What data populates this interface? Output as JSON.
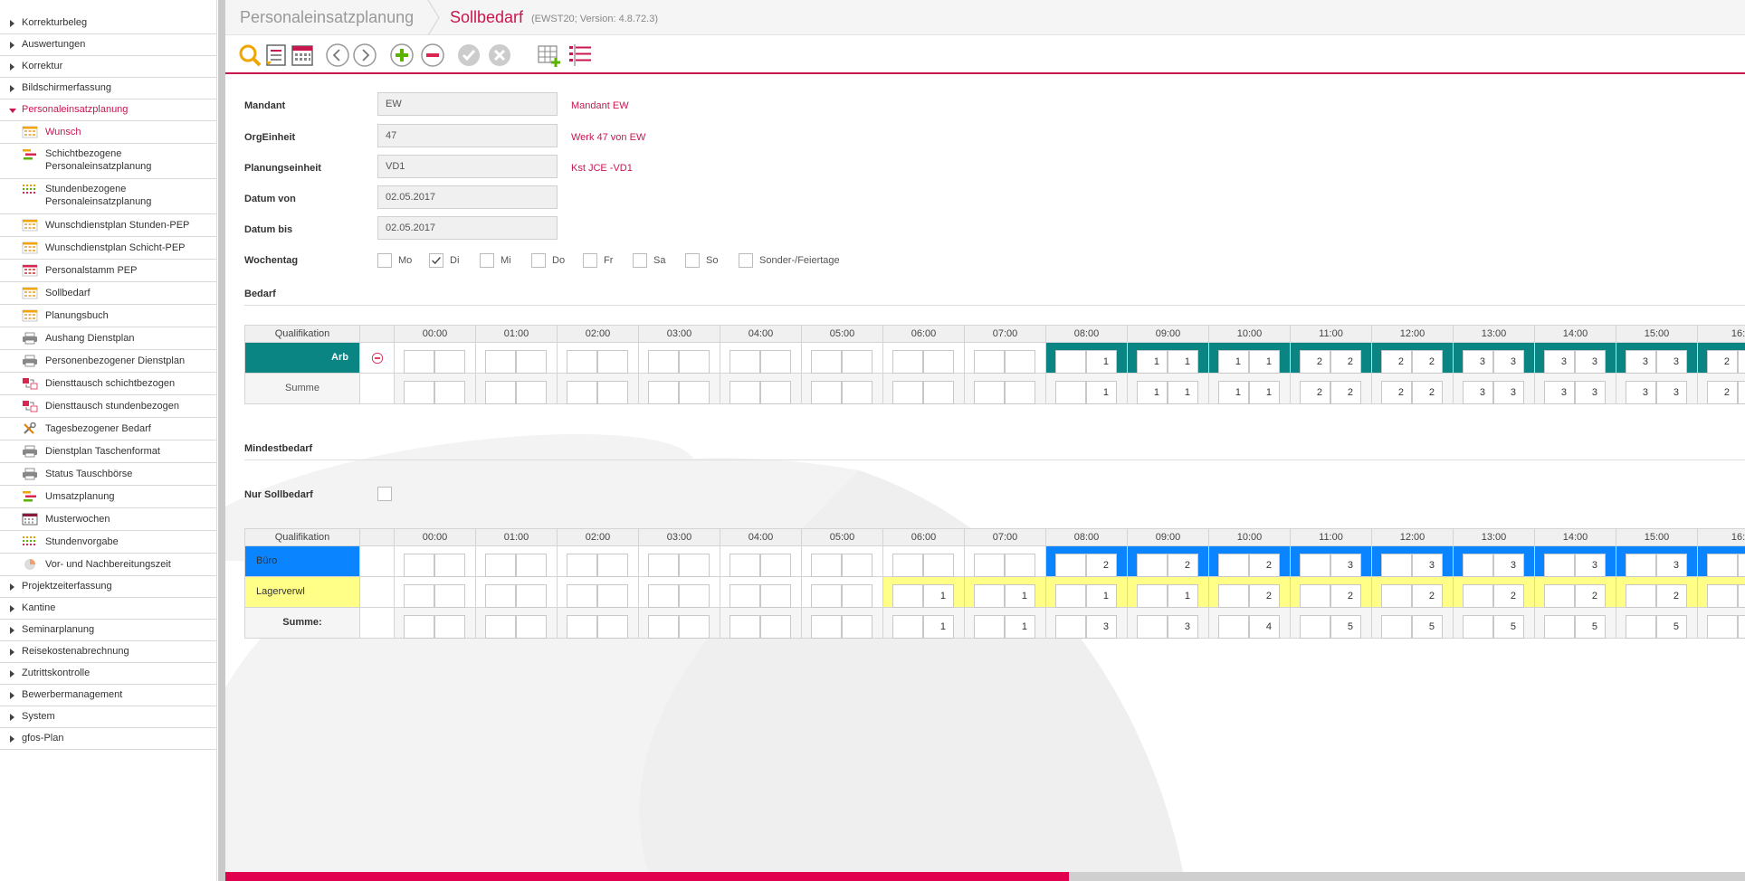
{
  "sidebar": {
    "sections_top": [
      "Korrekturbeleg",
      "Auswertungen",
      "Korrektur",
      "Bildschirmerfassung"
    ],
    "active_section": "Personaleinsatzplanung",
    "items": [
      {
        "label": "Wunsch",
        "icon": "grid-orange-icon",
        "active": true
      },
      {
        "label": "Schichtbezogene",
        "label2": "Personaleinsatzplanung",
        "icon": "gantt-bars-icon",
        "tall": true
      },
      {
        "label": "Stundenbezogene",
        "label2": "Personaleinsatzplanung",
        "icon": "dot-grid-icon",
        "tall": true
      },
      {
        "label": "Wunschdienstplan Stunden-PEP",
        "icon": "grid-orange-icon"
      },
      {
        "label": "Wunschdienstplan Schicht-PEP",
        "icon": "grid-orange-icon"
      },
      {
        "label": "Personalstamm PEP",
        "icon": "grid-red-icon"
      },
      {
        "label": "Sollbedarf",
        "icon": "grid-orange-icon"
      },
      {
        "label": "Planungsbuch",
        "icon": "grid-orange-icon"
      },
      {
        "label": "Aushang Dienstplan",
        "icon": "printer-icon"
      },
      {
        "label": "Personenbezogener Dienstplan",
        "icon": "printer-icon"
      },
      {
        "label": "Diensttausch schichtbezogen",
        "icon": "swap-calendar-icon"
      },
      {
        "label": "Diensttausch stundenbezogen",
        "icon": "swap-calendar-icon"
      },
      {
        "label": "Tagesbezogener Bedarf",
        "icon": "wrench-icon"
      },
      {
        "label": "Dienstplan Taschenformat",
        "icon": "printer-icon"
      },
      {
        "label": "Status Tauschbörse",
        "icon": "printer-icon"
      },
      {
        "label": "Umsatzplanung",
        "icon": "gantt-bars-icon"
      },
      {
        "label": "Musterwochen",
        "icon": "calendar-icon"
      },
      {
        "label": "Stundenvorgabe",
        "icon": "dot-grid-icon"
      },
      {
        "label": "Vor- und Nachbereitungszeit",
        "icon": "pie-icon"
      }
    ],
    "sections_bottom": [
      "Projektzeiterfassung",
      "Kantine",
      "Seminarplanung",
      "Reisekostenabrechnung",
      "Zutrittskontrolle",
      "Bewerbermanagement",
      "System",
      "gfos-Plan"
    ]
  },
  "breadcrumb": {
    "parent": "Personaleinsatzplanung",
    "current": "Sollbedarf",
    "version": "(EWST20; Version: 4.8.72.3)"
  },
  "toolbar": [
    "search-icon",
    "list-edit-icon",
    "calendar-icon",
    "prev-icon",
    "next-icon",
    "add-icon",
    "remove-icon",
    "confirm-icon",
    "cancel-icon",
    "table-add-icon",
    "table-list-icon"
  ],
  "form": {
    "mandant": {
      "label": "Mandant",
      "value": "EW",
      "info": "Mandant EW"
    },
    "orgeinheit": {
      "label": "OrgEinheit",
      "value": "47",
      "info": "Werk 47 von EW"
    },
    "planungseinheit": {
      "label": "Planungseinheit",
      "value": "VD1",
      "info": "Kst JCE -VD1"
    },
    "datum_von": {
      "label": "Datum von",
      "value": "02.05.2017"
    },
    "datum_bis": {
      "label": "Datum bis",
      "value": "02.05.2017"
    },
    "wochentag": {
      "label": "Wochentag",
      "days": [
        {
          "label": "Mo",
          "checked": false
        },
        {
          "label": "Di",
          "checked": true
        },
        {
          "label": "Mi",
          "checked": false
        },
        {
          "label": "Do",
          "checked": false
        },
        {
          "label": "Fr",
          "checked": false
        },
        {
          "label": "Sa",
          "checked": false
        },
        {
          "label": "So",
          "checked": false
        },
        {
          "label": "Sonder-/Feiertage",
          "checked": false
        }
      ]
    }
  },
  "bedarf": {
    "title": "Bedarf",
    "col_header": "Qualifikation",
    "hours": [
      "00:00",
      "01:00",
      "02:00",
      "03:00",
      "04:00",
      "05:00",
      "06:00",
      "07:00",
      "08:00",
      "09:00",
      "10:00",
      "11:00",
      "12:00",
      "13:00",
      "14:00",
      "15:00",
      "16:"
    ],
    "rows": [
      {
        "label": "Arb",
        "color": "#0b8583",
        "values": [
          [
            "",
            ""
          ],
          [
            "",
            ""
          ],
          [
            "",
            ""
          ],
          [
            "",
            ""
          ],
          [
            "",
            ""
          ],
          [
            "",
            ""
          ],
          [
            "",
            ""
          ],
          [
            "",
            ""
          ],
          [
            "",
            "1"
          ],
          [
            "1",
            "1"
          ],
          [
            "1",
            "1"
          ],
          [
            "2",
            "2"
          ],
          [
            "2",
            "2"
          ],
          [
            "3",
            "3"
          ],
          [
            "3",
            "3"
          ],
          [
            "3",
            "3"
          ],
          [
            "2",
            ""
          ]
        ]
      },
      {
        "label": "Summe",
        "values": [
          [
            "",
            ""
          ],
          [
            "",
            ""
          ],
          [
            "",
            ""
          ],
          [
            "",
            ""
          ],
          [
            "",
            ""
          ],
          [
            "",
            ""
          ],
          [
            "",
            ""
          ],
          [
            "",
            ""
          ],
          [
            "",
            "1"
          ],
          [
            "1",
            "1"
          ],
          [
            "1",
            "1"
          ],
          [
            "2",
            "2"
          ],
          [
            "2",
            "2"
          ],
          [
            "3",
            "3"
          ],
          [
            "3",
            "3"
          ],
          [
            "3",
            "3"
          ],
          [
            "2",
            ""
          ]
        ]
      }
    ]
  },
  "mindestbedarf": {
    "title": "Mindestbedarf",
    "nur_sollbedarf_label": "Nur Sollbedarf",
    "col_header": "Qualifikation",
    "hours": [
      "00:00",
      "01:00",
      "02:00",
      "03:00",
      "04:00",
      "05:00",
      "06:00",
      "07:00",
      "08:00",
      "09:00",
      "10:00",
      "11:00",
      "12:00",
      "13:00",
      "14:00",
      "15:00",
      "16:"
    ],
    "rows": [
      {
        "label": "Büro",
        "color": "#0a84ff",
        "color_from": 8,
        "values": [
          [
            "",
            ""
          ],
          [
            "",
            ""
          ],
          [
            "",
            ""
          ],
          [
            "",
            ""
          ],
          [
            "",
            ""
          ],
          [
            "",
            ""
          ],
          [
            "",
            ""
          ],
          [
            "",
            ""
          ],
          [
            "",
            "2"
          ],
          [
            "",
            "2"
          ],
          [
            "",
            "2"
          ],
          [
            "",
            "3"
          ],
          [
            "",
            "3"
          ],
          [
            "",
            "3"
          ],
          [
            "",
            "3"
          ],
          [
            "",
            "3"
          ],
          [
            "",
            ""
          ]
        ]
      },
      {
        "label": "Lagerverwl",
        "color": "#ffff88",
        "color_from": 6,
        "values": [
          [
            "",
            ""
          ],
          [
            "",
            ""
          ],
          [
            "",
            ""
          ],
          [
            "",
            ""
          ],
          [
            "",
            ""
          ],
          [
            "",
            ""
          ],
          [
            "",
            "1"
          ],
          [
            "",
            "1"
          ],
          [
            "",
            "1"
          ],
          [
            "",
            "1"
          ],
          [
            "",
            "2"
          ],
          [
            "",
            "2"
          ],
          [
            "",
            "2"
          ],
          [
            "",
            "2"
          ],
          [
            "",
            "2"
          ],
          [
            "",
            "2"
          ],
          [
            "",
            ""
          ]
        ]
      },
      {
        "label": "Summe:",
        "values": [
          [
            "",
            ""
          ],
          [
            "",
            ""
          ],
          [
            "",
            ""
          ],
          [
            "",
            ""
          ],
          [
            "",
            ""
          ],
          [
            "",
            ""
          ],
          [
            "",
            "1"
          ],
          [
            "",
            "1"
          ],
          [
            "",
            "3"
          ],
          [
            "",
            "3"
          ],
          [
            "",
            "4"
          ],
          [
            "",
            "5"
          ],
          [
            "",
            "5"
          ],
          [
            "",
            "5"
          ],
          [
            "",
            "5"
          ],
          [
            "",
            "5"
          ],
          [
            "",
            ""
          ]
        ]
      }
    ]
  },
  "colors": {
    "accent": "#c8174f",
    "teal": "#0b8583",
    "blue": "#0a84ff",
    "yellow": "#ffff88",
    "progress": "#e0004d"
  },
  "progress": 0.555
}
